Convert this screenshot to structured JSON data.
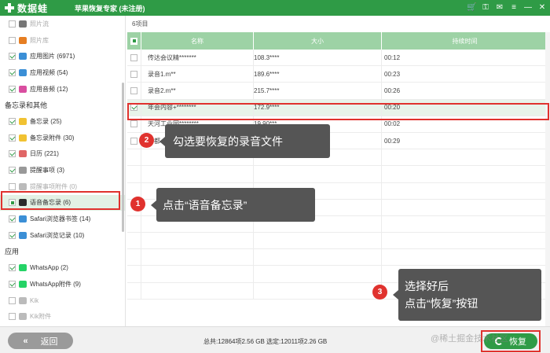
{
  "titlebar": {
    "logo_text": "数据蛙",
    "app_title": "苹果恢复专家 (未注册)",
    "controls": [
      "cart-icon",
      "key-icon",
      "feedback-icon",
      "menu-icon",
      "minimize-icon",
      "close-icon"
    ]
  },
  "sidebar": {
    "items": [
      {
        "label": "照片流",
        "state": "unchecked",
        "dim": true,
        "icon_color": "#777"
      },
      {
        "label": "照片库",
        "state": "unchecked",
        "dim": true,
        "icon_color": "#e67e22"
      },
      {
        "label": "应用图片 (6971)",
        "state": "checked",
        "dim": false,
        "icon_color": "#3b8fd6"
      },
      {
        "label": "应用视频 (54)",
        "state": "checked",
        "dim": false,
        "icon_color": "#3b8fd6"
      },
      {
        "label": "应用音频 (12)",
        "state": "checked",
        "dim": false,
        "icon_color": "#d94ea0"
      }
    ],
    "section_memo": "备忘录和其他",
    "memo_items": [
      {
        "label": "备忘录 (25)",
        "state": "checked",
        "dim": false,
        "icon_color": "#f1c232"
      },
      {
        "label": "备忘录附件 (30)",
        "state": "checked",
        "dim": false,
        "icon_color": "#f1c232"
      },
      {
        "label": "日历 (221)",
        "state": "checked",
        "dim": false,
        "icon_color": "#e06666"
      },
      {
        "label": "提醒事项 (3)",
        "state": "checked",
        "dim": false,
        "icon_color": "#999"
      },
      {
        "label": "提醒事项附件 (0)",
        "state": "unchecked",
        "dim": true,
        "icon_color": "#bbb"
      },
      {
        "label": "语音备忘录 (6)",
        "state": "partial",
        "dim": false,
        "icon_color": "#2b2b2b",
        "selected": true
      },
      {
        "label": "Safari浏览器书签 (14)",
        "state": "checked",
        "dim": false,
        "icon_color": "#3b8fd6"
      },
      {
        "label": "Safari浏览记录 (10)",
        "state": "checked",
        "dim": false,
        "icon_color": "#3b8fd6"
      }
    ],
    "section_apps": "应用",
    "app_items": [
      {
        "label": "WhatsApp (2)",
        "state": "checked",
        "dim": false,
        "icon_color": "#25d366"
      },
      {
        "label": "WhatsApp附件 (9)",
        "state": "checked",
        "dim": false,
        "icon_color": "#25d366"
      },
      {
        "label": "Kik",
        "state": "unchecked",
        "dim": true,
        "icon_color": "#bbb"
      },
      {
        "label": "Kik附件",
        "state": "unchecked",
        "dim": true,
        "icon_color": "#bbb"
      }
    ]
  },
  "main": {
    "count": "6项目",
    "columns": [
      "名称",
      "大小",
      "持续时间"
    ],
    "rows": [
      {
        "name": "传达会议精*******",
        "size": "108.3****",
        "duration": "00:12",
        "checked": false
      },
      {
        "name": "录音1.m**",
        "size": "189.6****",
        "duration": "00:23",
        "checked": false
      },
      {
        "name": "录音2.m**",
        "size": "215.7****",
        "duration": "00:26",
        "checked": false
      },
      {
        "name": "年会内容+********",
        "size": "172.9****",
        "duration": "00:20",
        "checked": true
      },
      {
        "name": "天河工业园********",
        "size": "19.90***",
        "duration": "00:02",
        "checked": false
      },
      {
        "name": "一都",
        "size": "",
        "duration": "00:29",
        "checked": false
      }
    ]
  },
  "bottombar": {
    "back_label": "返回",
    "summary": "总共:12864项2.56 GB 选定:12011项2.26 GB",
    "recover_label": "恢复",
    "watermark": "@稀土掘金技术社区"
  },
  "callouts": {
    "step1_num": "1",
    "step1_text": "点击“语音备忘录”",
    "step2_num": "2",
    "step2_text": "勾选要恢复的录音文件",
    "step3_num": "3",
    "step3_line1": "选择好后",
    "step3_line2": "点击“恢复”按钮"
  },
  "colors": {
    "brand_green": "#2f9b46",
    "header_green": "#9dd2a5",
    "highlight_red": "#e0322e",
    "callout_gray": "#555555"
  }
}
